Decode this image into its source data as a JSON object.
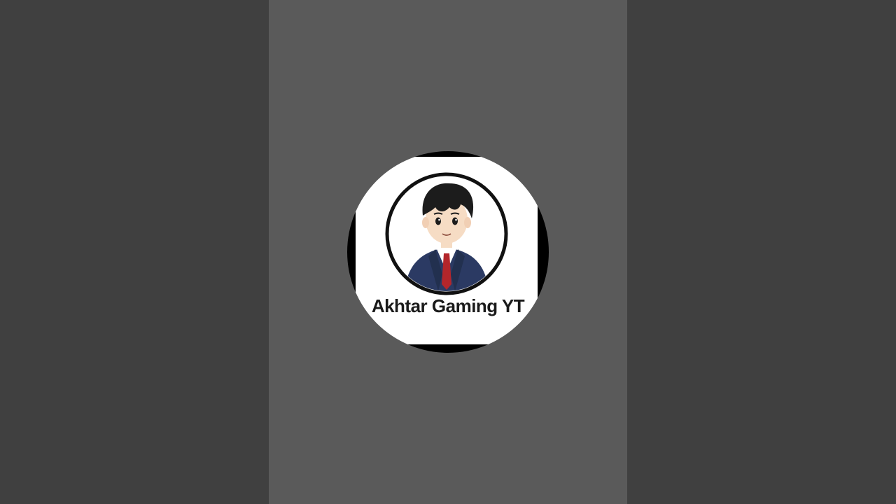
{
  "video": {
    "channel_logo": {
      "icon": "anime-avatar-icon",
      "text": "Akhtar Gaming YT"
    }
  },
  "colors": {
    "side_background": "#404040",
    "center_background": "#5a5a5a",
    "logo_ring": "#000000",
    "logo_background": "#ffffff",
    "suit": "#2b3a63",
    "tie": "#b3262b",
    "hair": "#1c1c1c",
    "skin": "#f6dcc4"
  }
}
